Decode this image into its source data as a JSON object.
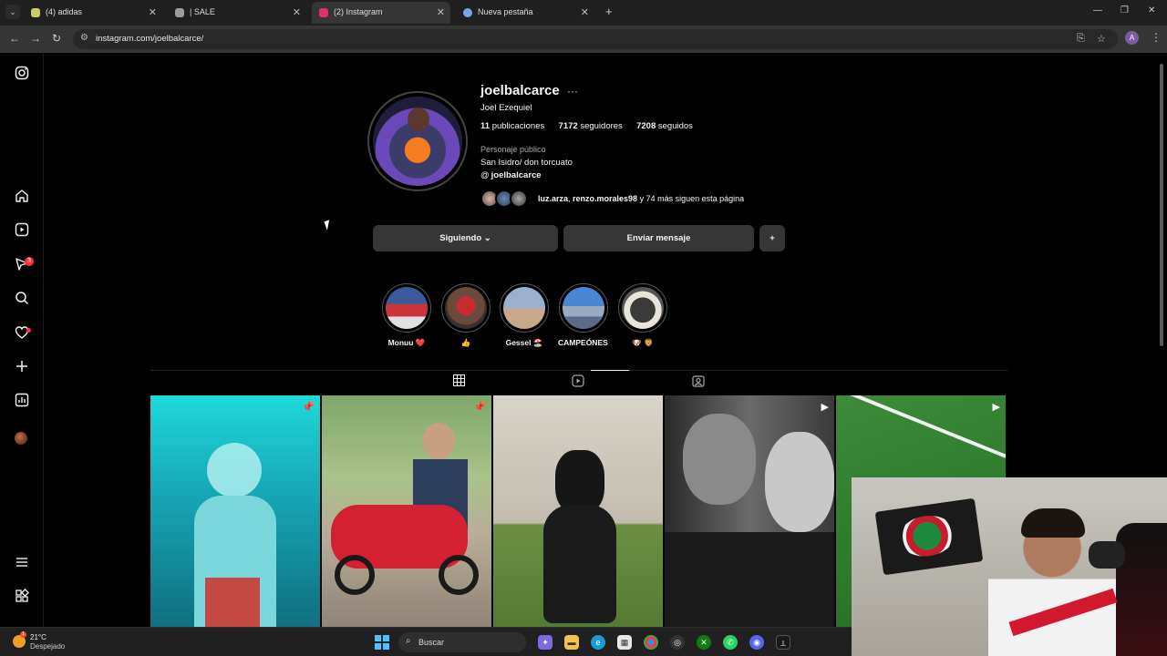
{
  "browser": {
    "tabs": [
      {
        "title": "(4) adidas",
        "active": false,
        "favicon_color": "#cccc66"
      },
      {
        "title": "| SALE",
        "active": false,
        "favicon_color": "#9a9a9a"
      },
      {
        "title": "(2) Instagram",
        "active": true,
        "favicon_color": "#e1306c"
      },
      {
        "title": "Nueva pestaña",
        "active": false,
        "favicon_color": "#7aa7e0"
      }
    ],
    "new_tab": "+",
    "url": "instagram.com/joelbalcarce/",
    "profile_initial": "A"
  },
  "sidebar": {
    "notifications_badge": "3",
    "items": [
      "instagram-logo",
      "home",
      "reels",
      "messages",
      "search",
      "notifications",
      "create",
      "dashboard",
      "profile",
      "more",
      "meta"
    ]
  },
  "profile": {
    "username": "joelbalcarce",
    "more": "···",
    "full_name": "Joel Ezequiel",
    "posts_count": "11",
    "posts_label": "publicaciones",
    "followers_count": "7172",
    "followers_label": "seguidores",
    "following_count": "7208",
    "following_label": "seguidos",
    "category": "Personaje público",
    "bio": "San Isidro/ don torcuato",
    "threads_handle": "joelbalcarce",
    "followed_by_1": "luz.arza",
    "followed_by_2": "renzo.morales98",
    "followed_by_rest": " y 74 más siguen esta página"
  },
  "buttons": {
    "following": "Siguiendo",
    "following_caret": "⌄",
    "message": "Enviar mensaje",
    "suggest": "+"
  },
  "highlights": [
    {
      "label": "Monuu ❤️"
    },
    {
      "label": "👍"
    },
    {
      "label": "Gessel 🏖️"
    },
    {
      "label": "CAMPEÓNES ..."
    },
    {
      "label": "🐶 🦁"
    }
  ],
  "taskbar": {
    "temperature": "21°C",
    "condition": "Despejado",
    "weather_badge": "1",
    "search_label": "Buscar"
  }
}
